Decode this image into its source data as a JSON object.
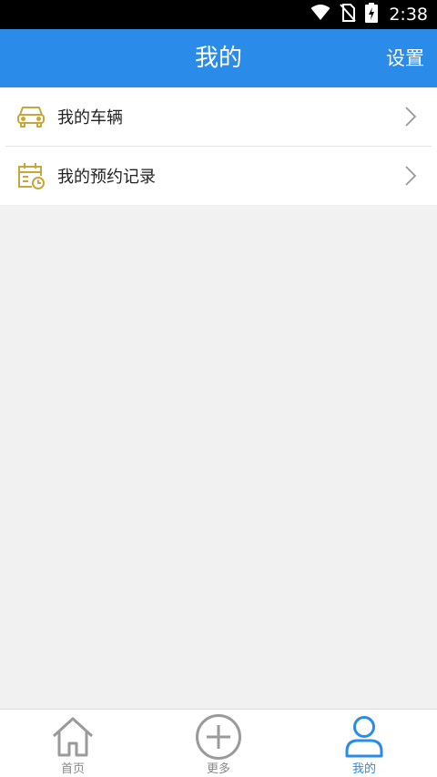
{
  "status_bar": {
    "time": "2:38",
    "icons": [
      "wifi-icon",
      "no-sim-icon",
      "battery-charging-icon"
    ]
  },
  "header": {
    "title": "我的",
    "settings_label": "设置"
  },
  "menu": {
    "items": [
      {
        "label": "我的车辆",
        "icon": "car-icon"
      },
      {
        "label": "我的预约记录",
        "icon": "calendar-clock-icon"
      }
    ]
  },
  "tab_bar": {
    "tabs": [
      {
        "label": "首页",
        "icon": "home-icon",
        "active": false
      },
      {
        "label": "更多",
        "icon": "plus-circle-icon",
        "active": false
      },
      {
        "label": "我的",
        "icon": "person-icon",
        "active": true
      }
    ]
  },
  "colors": {
    "primary": "#2a8be8",
    "icon_gold": "#c8a63c",
    "background": "#f1f1f1",
    "tab_inactive": "#888888"
  }
}
